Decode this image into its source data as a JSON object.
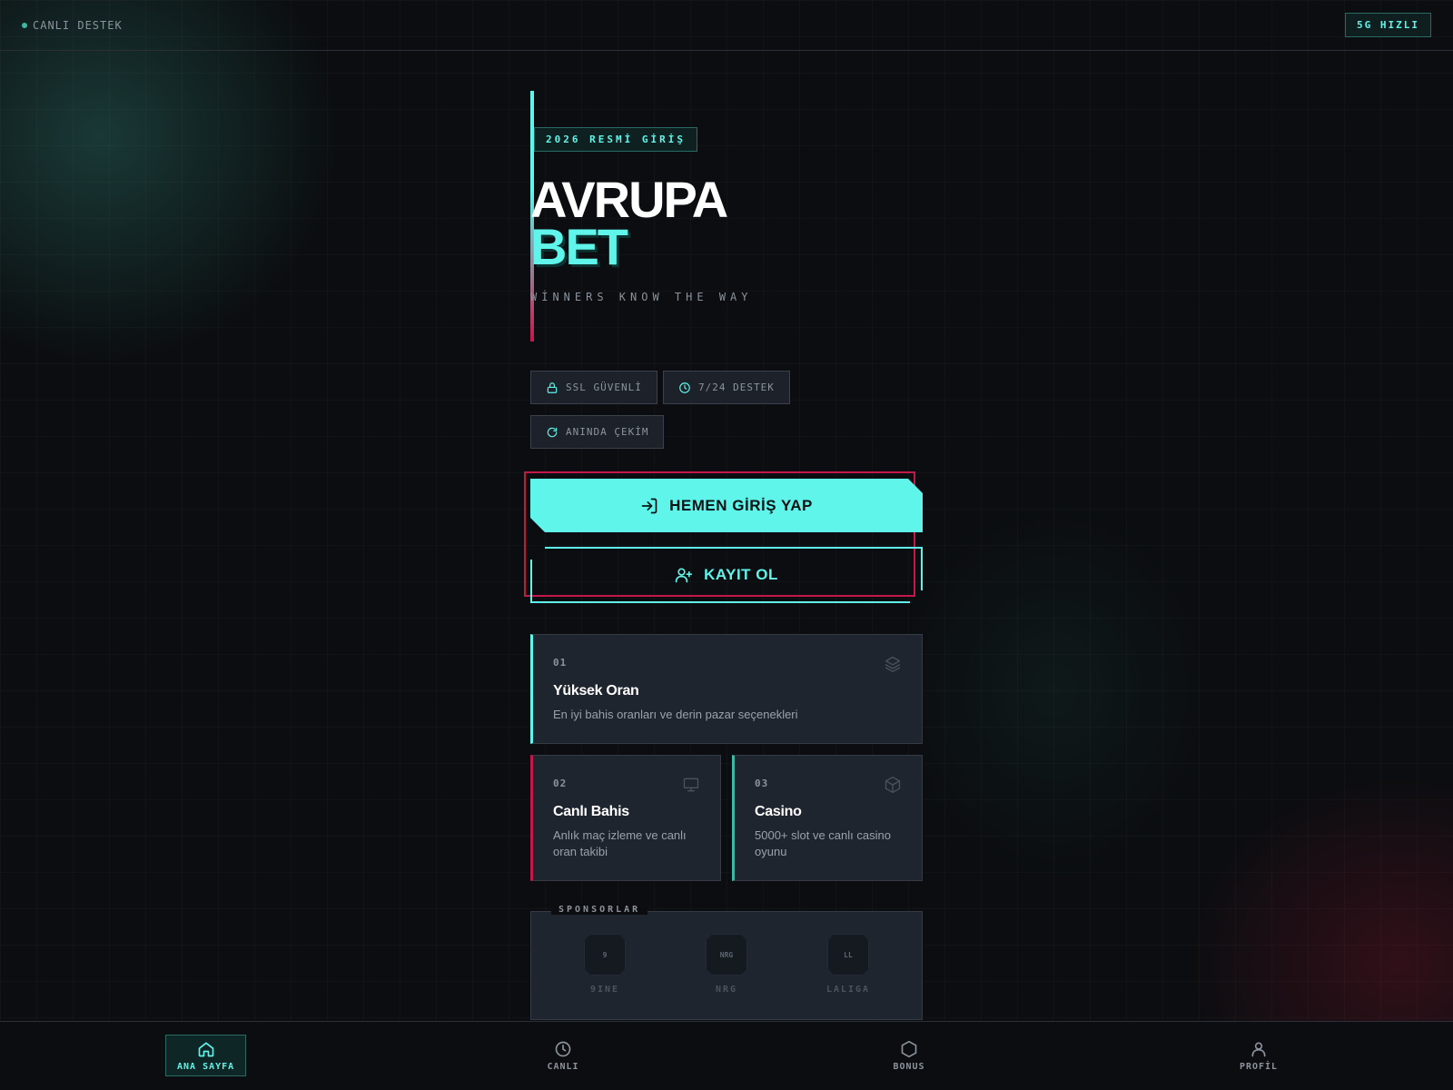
{
  "topbar": {
    "live_support": "CANLI DESTEK",
    "speed_badge": "5G HIZLI"
  },
  "hero": {
    "tag": "2026 RESMİ GİRİŞ",
    "title_line1": "AVRUPA",
    "title_line2": "BET",
    "slogan": "WİNNERS KNOW THE WAY"
  },
  "chips": [
    {
      "label": "SSL GÜVENLİ",
      "icon": "lock-icon"
    },
    {
      "label": "7/24 DESTEK",
      "icon": "clock-icon"
    },
    {
      "label": "ANINDA ÇEKİM",
      "icon": "refresh-icon"
    }
  ],
  "buttons": {
    "login": "HEMEN GİRİŞ YAP",
    "register": "KAYIT OL"
  },
  "features": [
    {
      "num": "01",
      "title": "Yüksek Oran",
      "desc": "En iyi bahis oranları ve derin pazar seçenekleri",
      "icon": "layers-icon"
    },
    {
      "num": "02",
      "title": "Canlı Bahis",
      "desc": "Anlık maç izleme ve canlı oran takibi",
      "icon": "monitor-icon"
    },
    {
      "num": "03",
      "title": "Casino",
      "desc": "5000+ slot ve canlı casino oyunu",
      "icon": "cube-icon"
    }
  ],
  "sponsors": {
    "label": "SPONSORLAR",
    "items": [
      {
        "logo": "9",
        "name": "9INE"
      },
      {
        "logo": "NRG",
        "name": "NRG"
      },
      {
        "logo": "LL",
        "name": "LALIGA"
      }
    ]
  },
  "nav": [
    {
      "label": "ANA SAYFA",
      "icon": "home-icon",
      "active": true
    },
    {
      "label": "CANLI",
      "icon": "clock-icon",
      "active": false
    },
    {
      "label": "BONUS",
      "icon": "hexagon-icon",
      "active": false
    },
    {
      "label": "PROFİL",
      "icon": "user-icon",
      "active": false
    }
  ],
  "colors": {
    "accent": "#5ff5ea",
    "danger": "#c4184a",
    "background": "#0b0d10",
    "card": "#1f252e"
  }
}
